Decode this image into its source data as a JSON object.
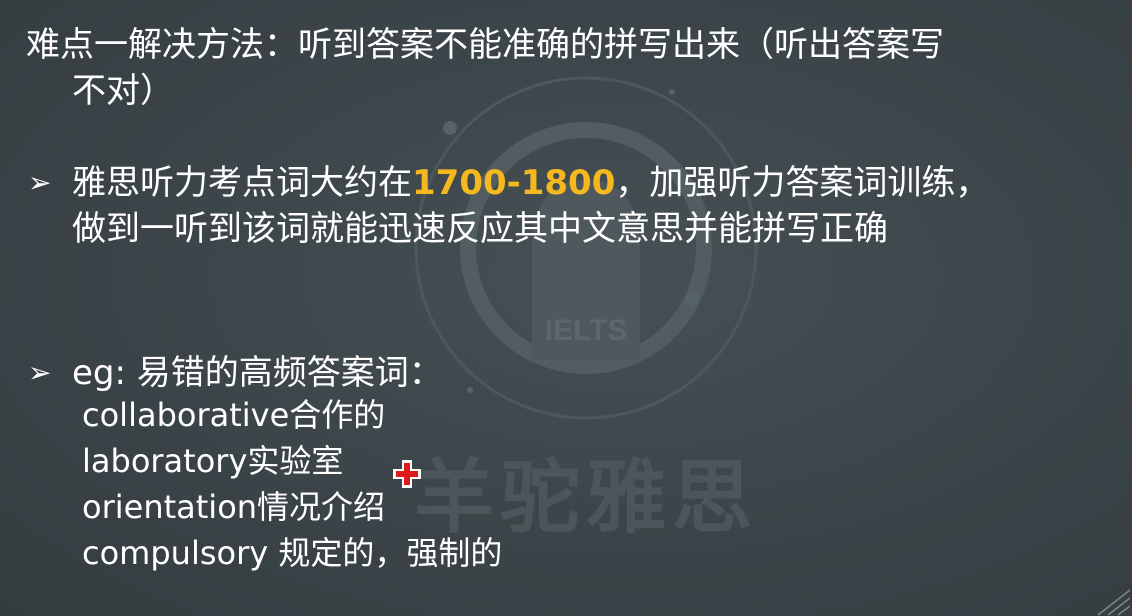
{
  "title": {
    "line1": "难点一解决方法：听到答案不能准确的拼写出来（听出答案写",
    "line2": "不对）"
  },
  "bullet1": {
    "arrow": "➢",
    "text_before": "雅思听力考点词大约在",
    "highlight": "1700-1800",
    "text_after": "，加强听力答案词训练，",
    "line2": "做到一听到该词就能迅速反应其中文意思并能拼写正确"
  },
  "bullet2": {
    "arrow": "➢",
    "text": "eg: 易错的高频答案词："
  },
  "words": [
    "collaborative合作的",
    "laboratory实验室",
    "orientation情况介绍",
    "compulsory 规定的，强制的"
  ],
  "watermark": {
    "ielts": "IELTS",
    "brand": "羊驼雅思"
  },
  "colors": {
    "background": "#3a4246",
    "text": "#ffffff",
    "highlight": "#f5b81f",
    "cursor": "#e0191b"
  }
}
